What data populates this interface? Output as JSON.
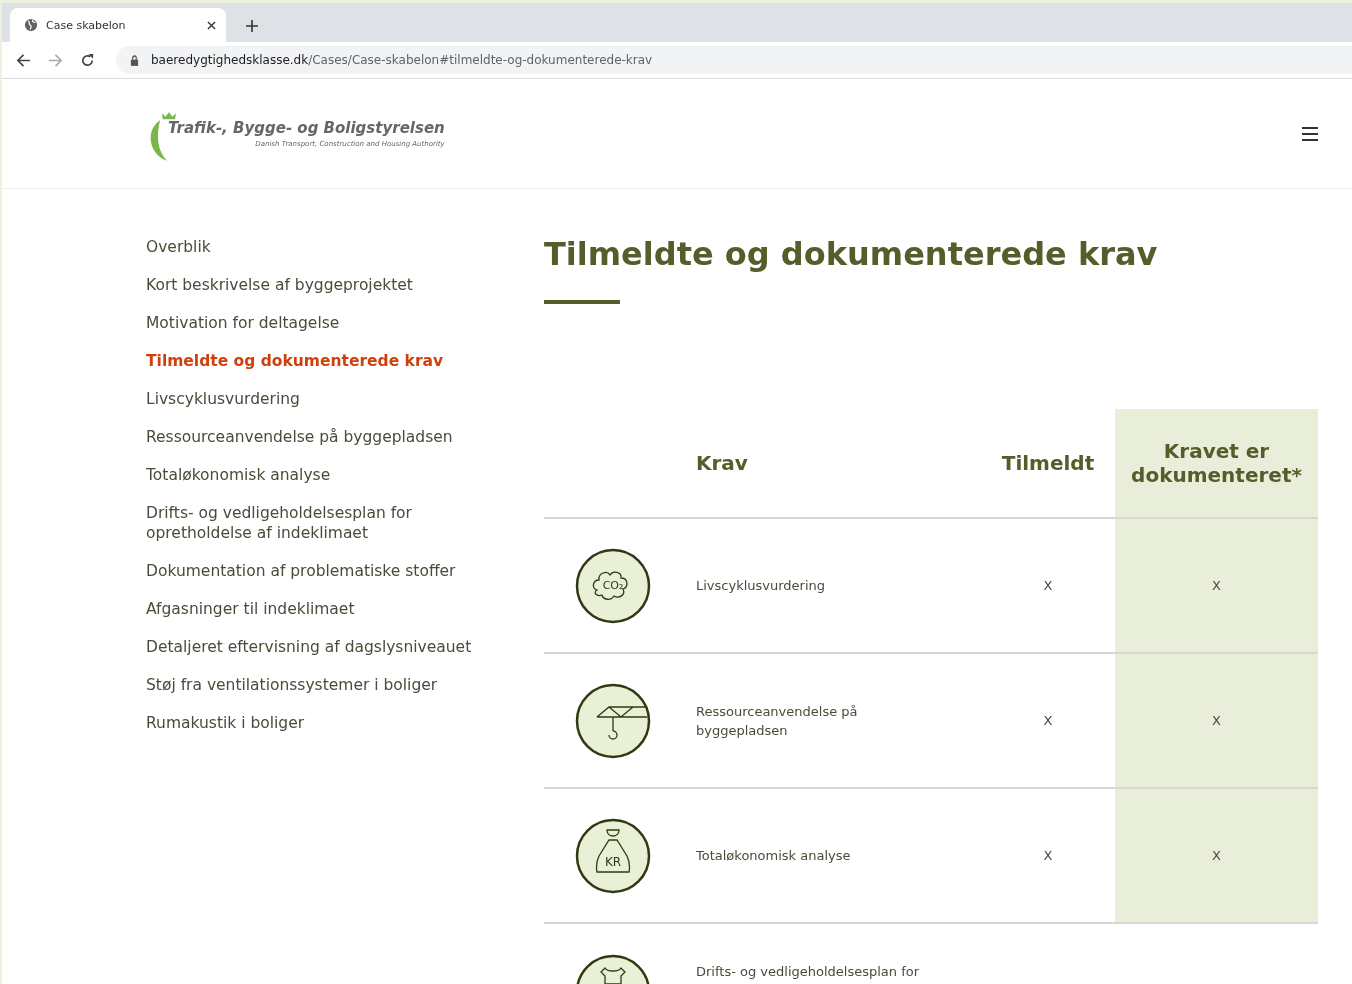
{
  "browser": {
    "tab_title": "Case skabelon",
    "url_domain": "baeredygtighedsklasse.dk",
    "url_path": "/Cases/Case-skabelon#tilmeldte-og-dokumenterede-krav"
  },
  "logo": {
    "name": "Trafik-, Bygge- og Boligstyrelsen",
    "tagline": "Danish Transport, Construction and Housing Authority"
  },
  "sidebar": {
    "items": [
      {
        "label": "Overblik",
        "selected": false
      },
      {
        "label": "Kort beskrivelse af byggeprojektet",
        "selected": false
      },
      {
        "label": "Motivation for deltagelse",
        "selected": false
      },
      {
        "label": "Tilmeldte og dokumenterede krav",
        "selected": true
      },
      {
        "label": "Livscyklusvurdering",
        "selected": false
      },
      {
        "label": "Ressourceanvendelse på byggepladsen",
        "selected": false
      },
      {
        "label": "Totaløkonomisk analyse",
        "selected": false
      },
      {
        "label": "Drifts- og vedligeholdelsesplan for opretholdelse af indeklimaet",
        "selected": false
      },
      {
        "label": "Dokumentation af problematiske stoffer",
        "selected": false
      },
      {
        "label": "Afgasninger til indeklimaet",
        "selected": false
      },
      {
        "label": "Detaljeret eftervisning af dagslysniveauet",
        "selected": false
      },
      {
        "label": "Støj fra ventilationssystemer i boliger",
        "selected": false
      },
      {
        "label": "Rumakustik i boliger",
        "selected": false
      }
    ]
  },
  "title": "Tilmeldte og dokumenterede krav",
  "table": {
    "columns": [
      "Krav",
      "Tilmeldt",
      "Kravet er dokumenteret*"
    ],
    "rows": [
      {
        "kind": "co2",
        "icon_text": "CO₂",
        "krav": "Livscyklusvurdering",
        "tilmeldt": "X",
        "dokumenteret": "X"
      },
      {
        "kind": "crane",
        "krav": "Ressourceanvendelse på byggepladsen",
        "tilmeldt": "X",
        "dokumenteret": "X"
      },
      {
        "kind": "moneybag",
        "icon_text": "KR",
        "krav": "Totaløkonomisk analyse",
        "tilmeldt": "X",
        "dokumenteret": "X"
      },
      {
        "kind": "shirt",
        "krav": "Drifts- og vedligeholdelsesplan for"
      }
    ]
  }
}
